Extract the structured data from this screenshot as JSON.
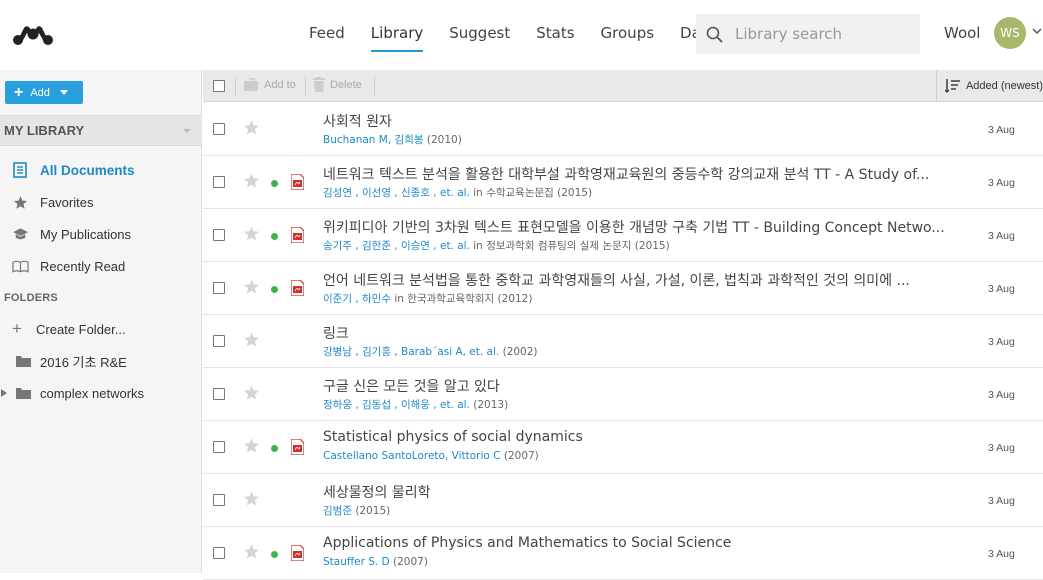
{
  "nav": {
    "items": [
      {
        "label": "Feed",
        "active": false
      },
      {
        "label": "Library",
        "active": true
      },
      {
        "label": "Suggest",
        "active": false
      },
      {
        "label": "Stats",
        "active": false
      },
      {
        "label": "Groups",
        "active": false
      },
      {
        "label": "Data",
        "active": false
      }
    ],
    "search_placeholder": "Library search",
    "user_name": "Wool",
    "avatar_initials": "WS",
    "avatar_color": "#a8b86a",
    "accent": "#2196d3"
  },
  "sidebar": {
    "add_label": "Add",
    "my_library": "MY LIBRARY",
    "items": [
      {
        "label": "All Documents",
        "icon": "documents-icon",
        "active": true
      },
      {
        "label": "Favorites",
        "icon": "star-icon",
        "active": false
      },
      {
        "label": "My Publications",
        "icon": "graduation-cap-icon",
        "active": false
      },
      {
        "label": "Recently Read",
        "icon": "book-open-icon",
        "active": false
      }
    ],
    "folders_header": "FOLDERS",
    "create_folder": "Create Folder...",
    "folders": [
      {
        "label": "2016 기초 R&E",
        "expandable": false
      },
      {
        "label": "complex networks",
        "expandable": true
      }
    ]
  },
  "toolbar": {
    "add_to": "Add to",
    "delete": "Delete",
    "sort_label": "Added (newest)"
  },
  "documents": [
    {
      "title": "사회적 원자",
      "authors": "Buchanan M, 김희봉",
      "in": "",
      "source": "",
      "year": "(2010)",
      "date": "3 Aug",
      "read": false,
      "pdf": false
    },
    {
      "title": "네트워크 텍스트 분석을 활용한 대학부설 과학영재교육원의 중등수학 강의교재 분석 TT - A Study of...",
      "authors": "김성연 , 이선영 , 신종호 , et. al.",
      "in": "in",
      "source": "수학교육논문집",
      "year": "(2015)",
      "date": "3 Aug",
      "read": true,
      "pdf": true
    },
    {
      "title": "위키피디아 기반의 3차원 텍스트 표현모델을 이용한 개념망 구축 기법 TT - Building Concept Netwo...",
      "authors": "송기주 , 김한준 , 이승연 , et. al.",
      "in": "in",
      "source": "정보과학회 컴퓨팅의 실제 논문지",
      "year": "(2015)",
      "date": "3 Aug",
      "read": true,
      "pdf": true
    },
    {
      "title": "언어 네트워크 분석법을 통한 중학교 과학영재들의 사실, 가설, 이론, 법칙과 과학적인 것의 의미에 ...",
      "authors": "이준기 , 하민수",
      "in": "in",
      "source": "한국과학교육학회지",
      "year": "(2012)",
      "date": "3 Aug",
      "read": true,
      "pdf": true
    },
    {
      "title": "링크",
      "authors": "강병남 , 김기흥 , Barab´asi A, et. al.",
      "in": "",
      "source": "",
      "year": "(2002)",
      "date": "3 Aug",
      "read": false,
      "pdf": false
    },
    {
      "title": "구글 신은 모든 것을 알고 있다",
      "authors": "정하웅 , 김동섭 , 이해웅 , et. al.",
      "in": "",
      "source": "",
      "year": "(2013)",
      "date": "3 Aug",
      "read": false,
      "pdf": false
    },
    {
      "title": "Statistical physics of social dynamics",
      "authors": "Castellano SantoLoreto, Vittorio C",
      "in": "",
      "source": "",
      "year": "(2007)",
      "date": "3 Aug",
      "read": true,
      "pdf": true
    },
    {
      "title": "세상물정의 물리학",
      "authors": "김범준",
      "in": "",
      "source": "",
      "year": "(2015)",
      "date": "3 Aug",
      "read": false,
      "pdf": false
    },
    {
      "title": "Applications of Physics and Mathematics to Social Science",
      "authors": "Stauffer S. D",
      "in": "",
      "source": "",
      "year": "(2007)",
      "date": "3 Aug",
      "read": true,
      "pdf": true
    }
  ]
}
